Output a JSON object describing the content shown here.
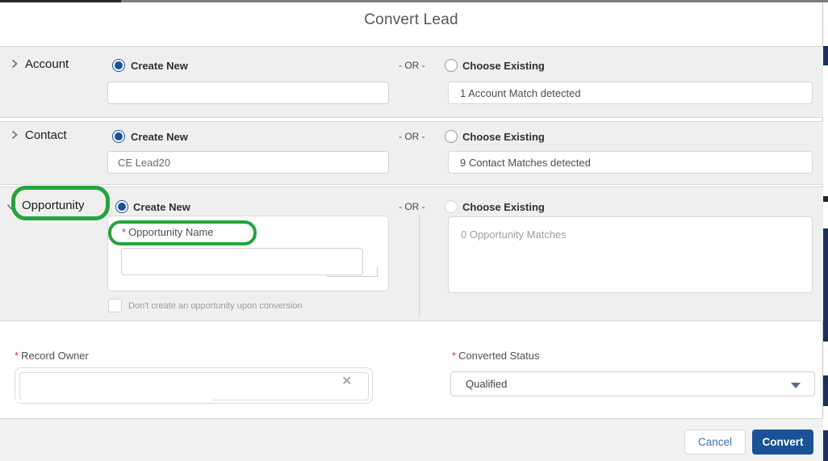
{
  "modal": {
    "title": "Convert Lead"
  },
  "sections": [
    {
      "label": "Account",
      "create_new": "Create New",
      "or": "- OR -",
      "choose_existing": "Choose Existing",
      "input_value": "",
      "match_text": "1 Account Match detected"
    },
    {
      "label": "Contact",
      "create_new": "Create New",
      "or": "- OR -",
      "choose_existing": "Choose Existing",
      "input_value": "CE Lead20",
      "match_text": "9 Contact Matches detected"
    },
    {
      "label": "Opportunity",
      "create_new": "Create New",
      "or": "- OR -",
      "choose_existing": "Choose Existing",
      "required_marker": "*",
      "opportunity_name_label": "Opportunity Name",
      "opportunity_name_value": "",
      "dont_create_label": "Don't create an opportunity upon conversion",
      "match_text": "0 Opportunity Matches"
    }
  ],
  "fields": {
    "required_marker": "*",
    "record_owner": {
      "label": "Record Owner",
      "value": "",
      "clear_icon": "✕"
    },
    "converted_status": {
      "label": "Converted Status",
      "value": "Qualified"
    }
  },
  "footer": {
    "cancel_label": "Cancel",
    "convert_label": "Convert"
  },
  "colors": {
    "brand_button": "#1b5297",
    "cancel_text": "#3e6fba",
    "annotation_green": "#23a53d",
    "section_background": "#f0efef",
    "edge_navy": "#16325c",
    "required_red": "#c23934"
  }
}
